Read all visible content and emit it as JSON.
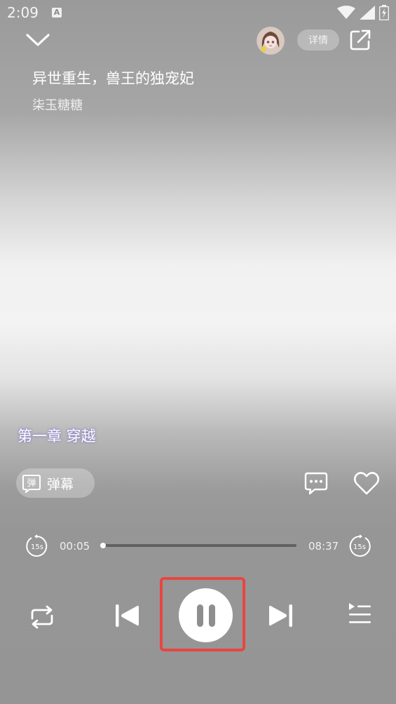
{
  "status_bar": {
    "time": "2:09",
    "app_icon": "A",
    "icons": [
      "wifi-icon",
      "signal-icon",
      "battery-icon"
    ]
  },
  "header": {
    "collapse_icon": "chevron-down-icon",
    "detail_label": "详情",
    "share_icon": "share-icon"
  },
  "book": {
    "title": "异世重生，兽王的独宠妃",
    "author": "柒玉糖糖"
  },
  "chapter": {
    "title": "第一章 穿越"
  },
  "danmaku": {
    "icon_text": "弹",
    "label": "弹幕"
  },
  "actions": {
    "comment_icon": "comment-icon",
    "favorite_icon": "heart-icon"
  },
  "progress": {
    "current_time": "00:05",
    "total_time": "08:37",
    "fraction": 0.01,
    "rewind_label": "15s",
    "forward_label": "15s"
  },
  "controls": {
    "loop_icon": "repeat-icon",
    "prev_icon": "skip-previous-icon",
    "play_state": "playing",
    "next_icon": "skip-next-icon",
    "playlist_icon": "playlist-icon"
  },
  "colors": {
    "highlight": "#e8463f",
    "chapter_glow": "#8a7ec7"
  }
}
